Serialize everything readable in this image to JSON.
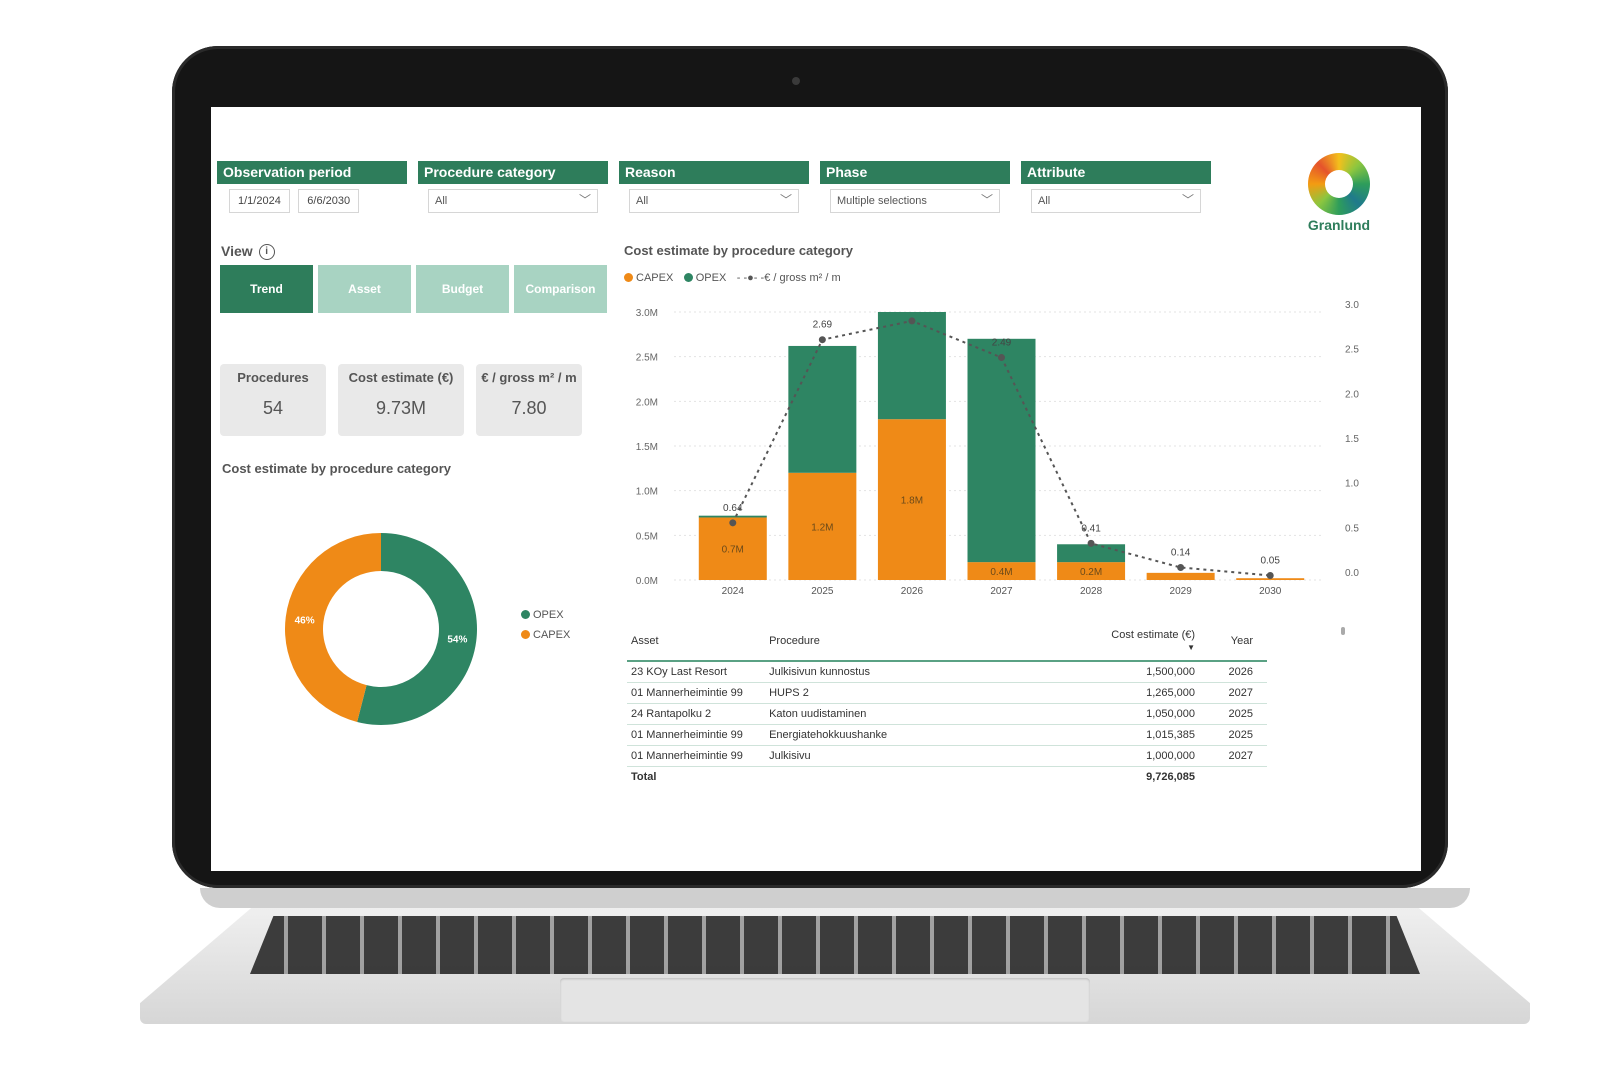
{
  "filters": {
    "observation_period": {
      "title": "Observation period",
      "start": "1/1/2024",
      "end": "6/6/2030"
    },
    "procedure_category": {
      "title": "Procedure category",
      "value": "All"
    },
    "reason": {
      "title": "Reason",
      "value": "All"
    },
    "phase": {
      "title": "Phase",
      "value": "Multiple selections"
    },
    "attribute": {
      "title": "Attribute",
      "value": "All"
    }
  },
  "brand": {
    "name": "Granlund",
    "color": "#2e7d5b"
  },
  "view": {
    "label": "View",
    "buttons": [
      {
        "label": "Trend",
        "active": true
      },
      {
        "label": "Asset",
        "active": false
      },
      {
        "label": "Budget",
        "active": false
      },
      {
        "label": "Comparison",
        "active": false
      }
    ]
  },
  "kpis": [
    {
      "title": "Procedures",
      "value": "54"
    },
    {
      "title": "Cost estimate (€)",
      "value": "9.73M"
    },
    {
      "title": "€ / gross m² / m",
      "value": "7.80"
    }
  ],
  "colors": {
    "opex": "#2e8563",
    "capex": "#ef8a17",
    "line": "#555555"
  },
  "donut": {
    "title": "Cost estimate by procedure category",
    "legend": [
      "OPEX",
      "CAPEX"
    ],
    "labels": {
      "opex": "54%",
      "capex": "46%"
    }
  },
  "bar_chart": {
    "title": "Cost estimate by procedure category",
    "legend": {
      "capex": "CAPEX",
      "opex": "OPEX",
      "line": "€ / gross m² / m"
    }
  },
  "chart_data": [
    {
      "type": "pie",
      "title": "Cost estimate by procedure category",
      "categories": [
        "OPEX",
        "CAPEX"
      ],
      "values": [
        54,
        46
      ]
    },
    {
      "type": "bar",
      "title": "Cost estimate by procedure category",
      "stacked": true,
      "categories": [
        "2024",
        "2025",
        "2026",
        "2027",
        "2028",
        "2029",
        "2030"
      ],
      "series": [
        {
          "name": "CAPEX",
          "values": [
            0.7,
            1.2,
            1.8,
            0.2,
            0.2,
            0.08,
            0.02
          ]
        },
        {
          "name": "OPEX",
          "values": [
            0.02,
            1.42,
            1.2,
            2.5,
            0.2,
            0,
            0
          ]
        },
        {
          "name": "€ / gross m² / m",
          "values": [
            0.64,
            2.69,
            2.9,
            2.49,
            0.41,
            0.14,
            0.05
          ],
          "axis": "right"
        }
      ],
      "bar_labels": {
        "capex": [
          "0.7M",
          "1.2M",
          "1.8M",
          "0.4M",
          "0.2M",
          "",
          ""
        ]
      },
      "line_labels": [
        "0.64",
        "2.69",
        "",
        "2.49",
        "0.41",
        "0.14",
        "0.05"
      ],
      "yticks_left": [
        "0.0M",
        "0.5M",
        "1.0M",
        "1.5M",
        "2.0M",
        "2.5M",
        "3.0M"
      ],
      "yticks_right": [
        "0.0",
        "0.5",
        "1.0",
        "1.5",
        "2.0",
        "2.5",
        "3.0"
      ],
      "ylim": [
        0,
        3.0
      ],
      "ylim_right": [
        0,
        3.0
      ],
      "grid": true,
      "legend_position": "top-left"
    }
  ],
  "table": {
    "headers": [
      "Asset",
      "Procedure",
      "Cost estimate (€)",
      "Year"
    ],
    "rows": [
      [
        "23 KOy Last Resort",
        "Julkisivun kunnostus",
        "1,500,000",
        "2026"
      ],
      [
        "01 Mannerheimintie 99",
        "HUPS 2",
        "1,265,000",
        "2027"
      ],
      [
        "24 Rantapolku 2",
        "Katon uudistaminen",
        "1,050,000",
        "2025"
      ],
      [
        "01 Mannerheimintie 99",
        "Energiatehokkuushanke",
        "1,015,385",
        "2025"
      ],
      [
        "01 Mannerheimintie 99",
        "Julkisivu",
        "1,000,000",
        "2027"
      ]
    ],
    "total": {
      "label": "Total",
      "value": "9,726,085"
    }
  }
}
